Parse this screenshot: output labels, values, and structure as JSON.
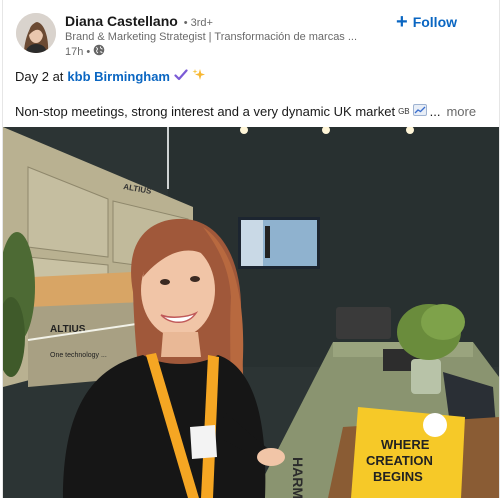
{
  "post": {
    "author": {
      "name": "Diana Castellano",
      "degree": "• 3rd+",
      "headline": "Brand & Marketing Strategist | Transformación de marcas ...",
      "time": "17h •"
    },
    "follow_label": "Follow",
    "text_line1_prefix": "Day 2 at",
    "text_link": "kbb Birmingham",
    "text_line2": "Non-stop meetings, strong interest and a very dynamic UK market",
    "flag_text": "GB",
    "ellipsis": "...",
    "more_label": "more"
  },
  "photo": {
    "cabinet_brand": "ALTIUS",
    "panel_brand": "ALTIUS",
    "panel_tagline": "One technology ...",
    "counter_text": "HARM",
    "book_title_lines": [
      "WHERE",
      "CREATION",
      "BEGINS"
    ]
  },
  "colors": {
    "accent": "#0a66c2",
    "lanyard": "#f5a623",
    "book_yellow": "#f6c928"
  },
  "icons": {
    "globe": "globe-icon",
    "check": "check-icon",
    "sparkle": "sparkle-icon",
    "chart": "chart-icon",
    "plus": "plus-icon"
  }
}
